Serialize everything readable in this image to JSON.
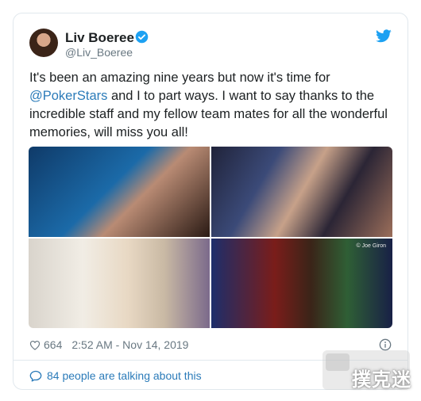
{
  "author": {
    "name": "Liv Boeree",
    "handle": "@Liv_Boeree"
  },
  "tweet": {
    "text_before": "It's been an amazing nine years but now it's time for ",
    "mention": "@PokerStars",
    "text_after": " and I to part ways. I want to say thanks to the incredible staff and my fellow team mates for all the wonderful memories, will miss you all!"
  },
  "media": {
    "photo_credit": "© Joe Giron"
  },
  "meta": {
    "likes": "664",
    "timestamp": "2:52 AM - Nov 14, 2019"
  },
  "footer": {
    "talking": "84 people are talking about this"
  },
  "watermark": {
    "text": "撲克迷"
  },
  "colors": {
    "link": "#2b7bb9",
    "muted": "#697882",
    "border": "#e1e8ed",
    "twitter_blue": "#1da1f2"
  }
}
